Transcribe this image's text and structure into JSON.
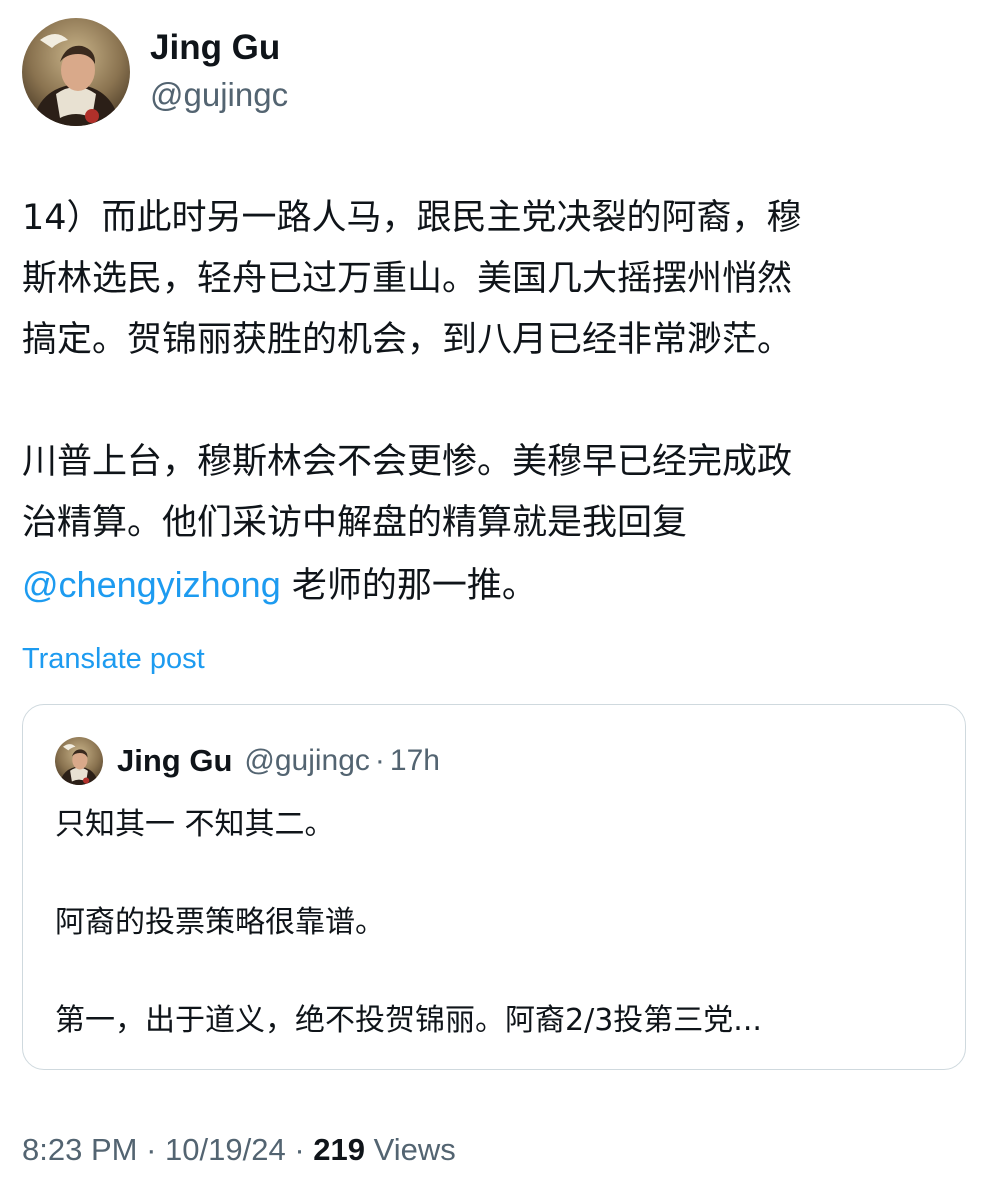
{
  "author": {
    "display_name": "Jing Gu",
    "handle": "@gujingc",
    "avatar_icon": "portrait-avatar"
  },
  "tweet": {
    "paragraph1": "14）而此时另一路人马，跟民主党决裂的阿裔，穆\n斯林选民，轻舟已过万重山。美国几大摇摆州悄然\n搞定。贺锦丽获胜的机会，到八月已经非常渺茫。",
    "paragraph2": "川普上台，穆斯林会不会更惨。美穆早已经完成政\n治精算。他们采访中解盘的精算就是我回复",
    "mention": "@chengyizhong",
    "paragraph2_tail": " 老师的那一推。",
    "translate_label": "Translate post"
  },
  "quoted": {
    "display_name": "Jing Gu",
    "handle": "@gujingc",
    "separator": "·",
    "time": "17h",
    "lines": [
      "只知其一 不知其二。",
      "阿裔的投票策略很靠谱。",
      "第一，出于道义，绝不投贺锦丽。阿裔2/3投第三党..."
    ]
  },
  "meta": {
    "time": "8:23 PM",
    "date": "10/19/24",
    "separator": "·",
    "views_count": "219",
    "views_label": "Views"
  },
  "colors": {
    "accent": "#1d9bf0",
    "text": "#0f1419",
    "secondary": "#536471",
    "border": "#cfd9de"
  }
}
